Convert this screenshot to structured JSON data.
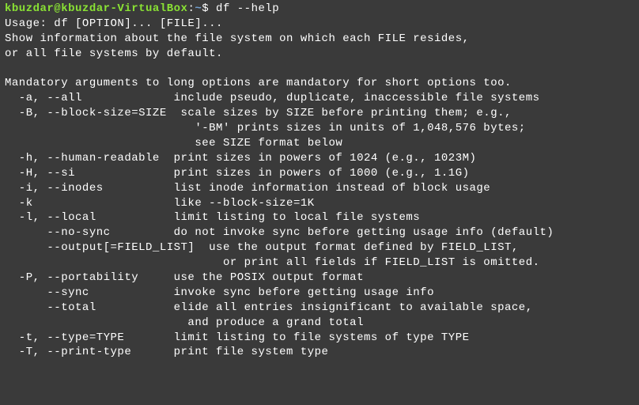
{
  "prompt": {
    "user_host": "kbuzdar@kbuzdar-VirtualBox",
    "colon": ":",
    "path": "~",
    "dollar": "$"
  },
  "command": " df --help",
  "lines": {
    "l0": "Usage: df [OPTION]... [FILE]...",
    "l1": "Show information about the file system on which each FILE resides,",
    "l2": "or all file systems by default.",
    "l3": "",
    "l4": "Mandatory arguments to long options are mandatory for short options too.",
    "l5": "  -a, --all             include pseudo, duplicate, inaccessible file systems",
    "l6": "  -B, --block-size=SIZE  scale sizes by SIZE before printing them; e.g.,",
    "l7": "                           '-BM' prints sizes in units of 1,048,576 bytes;",
    "l8": "                           see SIZE format below",
    "l9": "  -h, --human-readable  print sizes in powers of 1024 (e.g., 1023M)",
    "l10": "  -H, --si              print sizes in powers of 1000 (e.g., 1.1G)",
    "l11": "  -i, --inodes          list inode information instead of block usage",
    "l12": "  -k                    like --block-size=1K",
    "l13": "  -l, --local           limit listing to local file systems",
    "l14": "      --no-sync         do not invoke sync before getting usage info (default)",
    "l15": "      --output[=FIELD_LIST]  use the output format defined by FIELD_LIST,",
    "l16": "                               or print all fields if FIELD_LIST is omitted.",
    "l17": "  -P, --portability     use the POSIX output format",
    "l18": "      --sync            invoke sync before getting usage info",
    "l19": "      --total           elide all entries insignificant to available space,",
    "l20": "                          and produce a grand total",
    "l21": "  -t, --type=TYPE       limit listing to file systems of type TYPE",
    "l22": "  -T, --print-type      print file system type"
  }
}
